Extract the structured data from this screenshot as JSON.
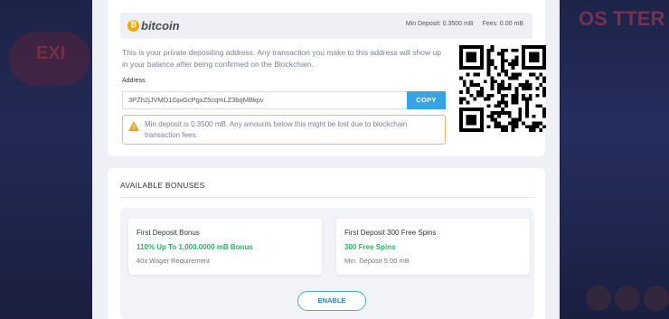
{
  "backdrop": {
    "left_art_text": "EXI",
    "right_art_text": "OS TTER"
  },
  "deposit": {
    "coin_name": "bitcoin",
    "coin_icon_glyph": "₿",
    "min_deposit_label": "Min Deposit: 0.3500 mB",
    "fees_label": "Fees: 0.00 mB",
    "info_text": "This is your private depositing address. Any transaction you make to this address will show up in your balance after being confirmed on the Blockchain.",
    "address_label": "Address",
    "address_value": "3PZh2jJVMD1GpiGcPgxZ5cqmLZ3bqMBkpv",
    "copy_label": "COPY",
    "warning_text": "Min deposit is 0.3500 mB. Any amounts below this might be lost due to blockchain transaction fees."
  },
  "bonuses": {
    "section_title": "AVAILABLE BONUSES",
    "cards": [
      {
        "title": "First Deposit Bonus",
        "highlight": "110% Up To 1,000.0000 mB Bonus",
        "note": "40x Wager Requirement"
      },
      {
        "title": "First Deposit 300 Free Spins",
        "highlight": "300 Free Spins",
        "note": "Min. Deposit 5.00 mB"
      }
    ],
    "enable_label": "ENABLE"
  },
  "colors": {
    "accent_blue": "#36a3e6",
    "bitcoin_orange": "#f2a900",
    "success_green": "#2fb166",
    "warning_yellow": "#e5c06a"
  }
}
